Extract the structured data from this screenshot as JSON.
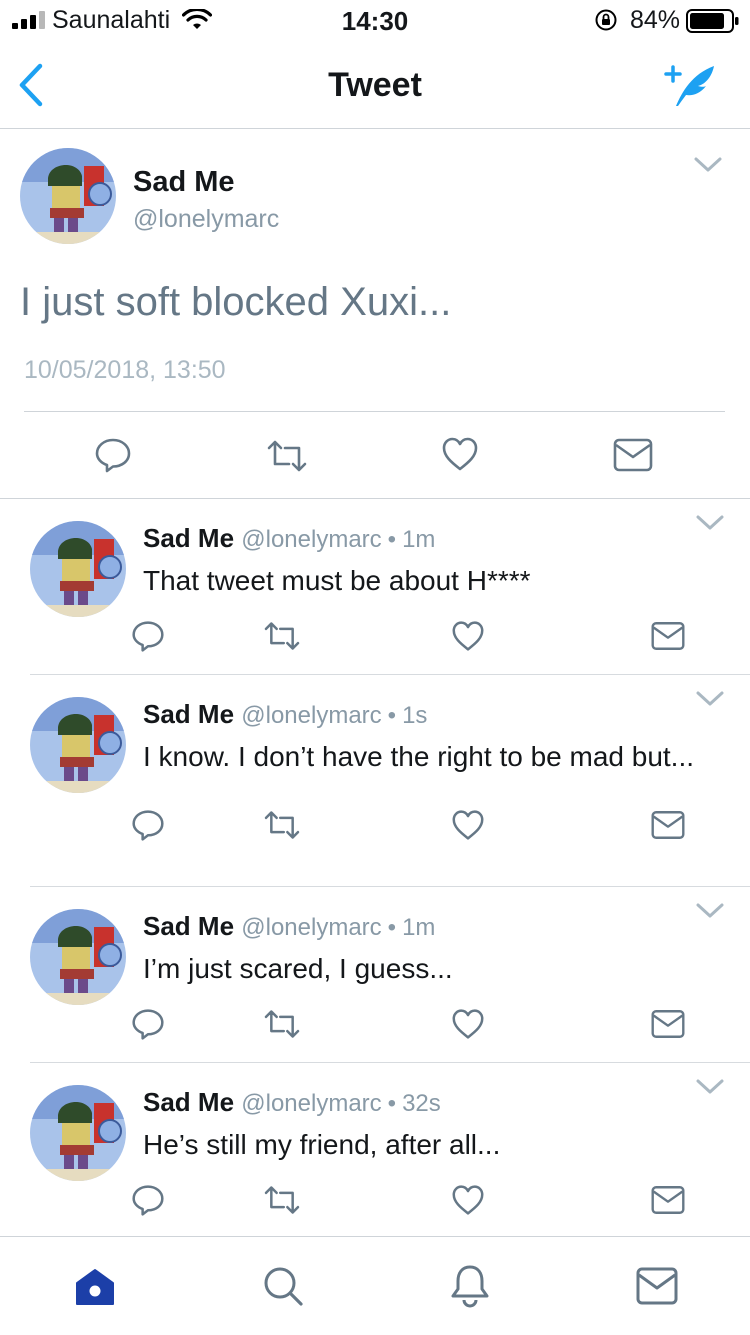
{
  "status_bar": {
    "carrier": "Saunalahti",
    "time": "14:30",
    "battery": "84%"
  },
  "nav": {
    "title": "Tweet"
  },
  "main_tweet": {
    "name": "Sad Me",
    "handle": "@lonelymarc",
    "text": "I just soft blocked Xuxi...",
    "timestamp": "10/05/2018, 13:50"
  },
  "replies": [
    {
      "name": "Sad Me",
      "handle": "@lonelymarc",
      "age": "1m",
      "text": "That tweet must be about H****"
    },
    {
      "name": "Sad Me",
      "handle": "@lonelymarc",
      "age": "1s",
      "text": "I know. I don’t have the right to be mad but..."
    },
    {
      "name": "Sad Me",
      "handle": "@lonelymarc",
      "age": "1m",
      "text": "I’m just scared, I guess..."
    },
    {
      "name": "Sad Me",
      "handle": "@lonelymarc",
      "age": "32s",
      "text": "He’s still my friend, after all..."
    }
  ],
  "separator": "•",
  "colors": {
    "accent": "#1da1f2",
    "icon": "#657786",
    "tab_active": "#1c3fa8",
    "text_secondary": "#8899a6"
  },
  "icons": {
    "reply": "reply-icon",
    "retweet": "retweet-icon",
    "like": "like-icon",
    "dm": "direct-message-icon",
    "tab_home": "home-icon",
    "tab_search": "search-icon",
    "tab_notifications": "bell-icon",
    "tab_messages": "mail-icon"
  }
}
